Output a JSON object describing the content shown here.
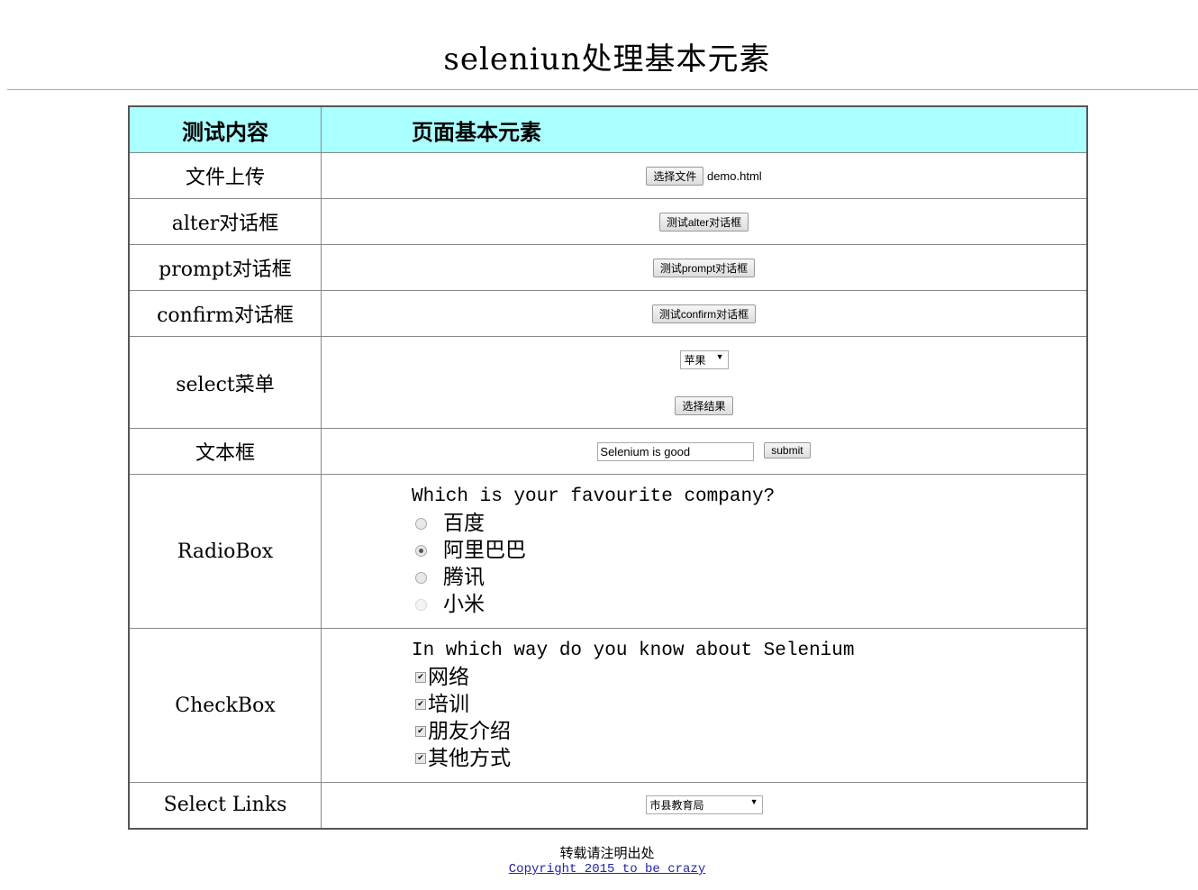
{
  "title": "seleniun处理基本元素",
  "table": {
    "header": [
      "测试内容",
      "页面基本元素"
    ],
    "rows": {
      "upload": {
        "label": "文件上传",
        "button": "选择文件",
        "file": "demo.html"
      },
      "alert": {
        "label": "alter对话框",
        "button": "测试alter对话框"
      },
      "prompt": {
        "label": "prompt对话框",
        "button": "测试prompt对话框"
      },
      "confirm": {
        "label": "confirm对话框",
        "button": "测试confirm对话框"
      },
      "select": {
        "label": "select菜单",
        "selected": "苹果",
        "button": "选择结果"
      },
      "text": {
        "label": "文本框",
        "value": "Selenium is good",
        "button": "submit"
      },
      "radio": {
        "label": "RadioBox",
        "question": "Which is your favourite company?",
        "options": [
          "百度",
          "阿里巴巴",
          "腾讯",
          "小米"
        ],
        "selected": "阿里巴巴",
        "disabled": "小米"
      },
      "checkbox": {
        "label": "CheckBox",
        "question": "In which way do you know about Selenium",
        "options": [
          "网络",
          "培训",
          "朋友介绍",
          "其他方式"
        ],
        "checked": [
          true,
          true,
          true,
          true
        ]
      },
      "links": {
        "label": "Select Links",
        "selected": "市县教育局"
      }
    }
  },
  "footer": {
    "note": "转载请注明出处",
    "copyright": "Copyright 2015 to be crazy"
  },
  "colors": {
    "header_bg": "#aaffff",
    "link": "#2222aa"
  }
}
